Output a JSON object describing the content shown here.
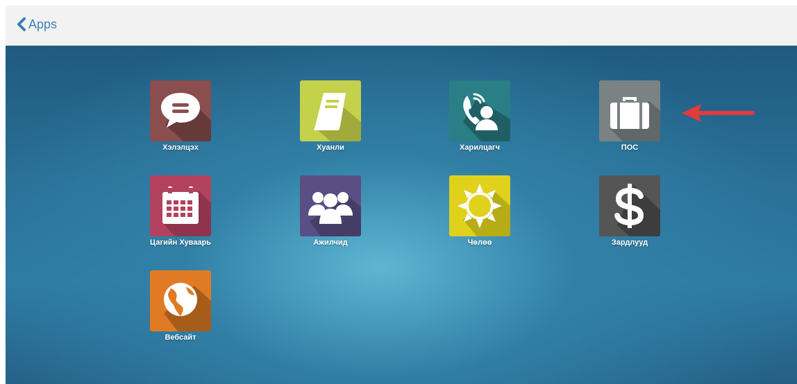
{
  "header": {
    "back_label": "Apps"
  },
  "apps": [
    {
      "label": "Хэлэлцэх",
      "color": "#8a4e4e",
      "icon": "chat-bubble-icon"
    },
    {
      "label": "Хуанли",
      "color": "#c4d14a",
      "icon": "notebook-icon"
    },
    {
      "label": "Харилцагч",
      "color": "#2a7f86",
      "icon": "phone-contact-icon"
    },
    {
      "label": "ПОС",
      "color": "#7a8284",
      "icon": "briefcase-icon"
    },
    {
      "label": "Цагийн Хуваарь",
      "color": "#b3425f",
      "icon": "calendar-icon"
    },
    {
      "label": "Ажилчид",
      "color": "#5a4f84",
      "icon": "people-icon"
    },
    {
      "label": "Чөлөө",
      "color": "#e0d11c",
      "icon": "sun-icon"
    },
    {
      "label": "Зардлууд",
      "color": "#555555",
      "icon": "dollar-icon"
    },
    {
      "label": "Вебсайт",
      "color": "#e07b24",
      "icon": "globe-icon"
    }
  ],
  "annotation": {
    "arrow_color": "#e23b3b"
  }
}
